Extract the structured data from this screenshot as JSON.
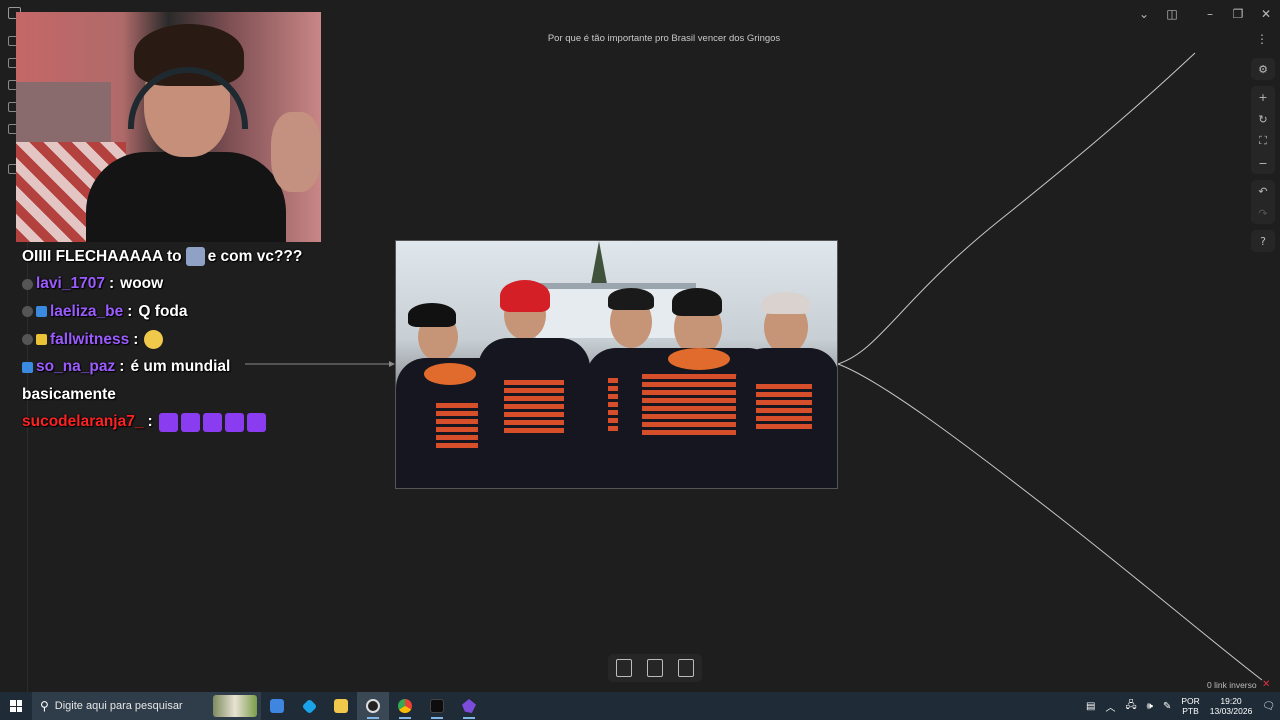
{
  "window": {
    "note_title": "Por que é tão importante pro Brasil vencer dos Gringos",
    "controls": [
      "chevron-down-icon",
      "sidebar-toggle-icon",
      "minimize-icon",
      "restore-icon",
      "close-icon"
    ]
  },
  "canvas": {
    "right_controls": [
      "settings-icon",
      "zoom-in-icon",
      "reset-icon",
      "fit-icon",
      "zoom-out-icon",
      "undo-icon",
      "redo-icon",
      "help-icon"
    ],
    "bottom_tools": [
      "new-note-icon",
      "new-file-icon",
      "new-media-icon"
    ],
    "status": "0 link inverso"
  },
  "chat": {
    "messages": [
      {
        "user": "",
        "text": "OIIII FLECHAAAAA to",
        "text2": "e com vc???",
        "user_color": "#ffffff"
      },
      {
        "user": "lavi_1707",
        "text": "woow",
        "user_color": "#9b5bff"
      },
      {
        "user": "laeliza_be",
        "text": "Q foda",
        "user_color": "#9b5bff"
      },
      {
        "user": "fallwitness",
        "text": "",
        "user_color": "#9b5bff"
      },
      {
        "user": "so_na_paz",
        "text": "é um mundial",
        "user_color": "#9b5bff"
      },
      {
        "user": "",
        "text": "basicamente",
        "user_color": "#ffffff"
      },
      {
        "user": "sucodelaranja7_",
        "text": "",
        "user_color": "#ff2222"
      }
    ]
  },
  "taskbar": {
    "search_placeholder": "Digite aqui para pesquisar",
    "lang_line1": "POR",
    "lang_line2": "PTB",
    "time": "19:20",
    "date": "13/03/2026"
  },
  "colors": {
    "background": "#1e1e1e",
    "taskbar": "#1f2b36",
    "edge": "#c8c8c8"
  }
}
